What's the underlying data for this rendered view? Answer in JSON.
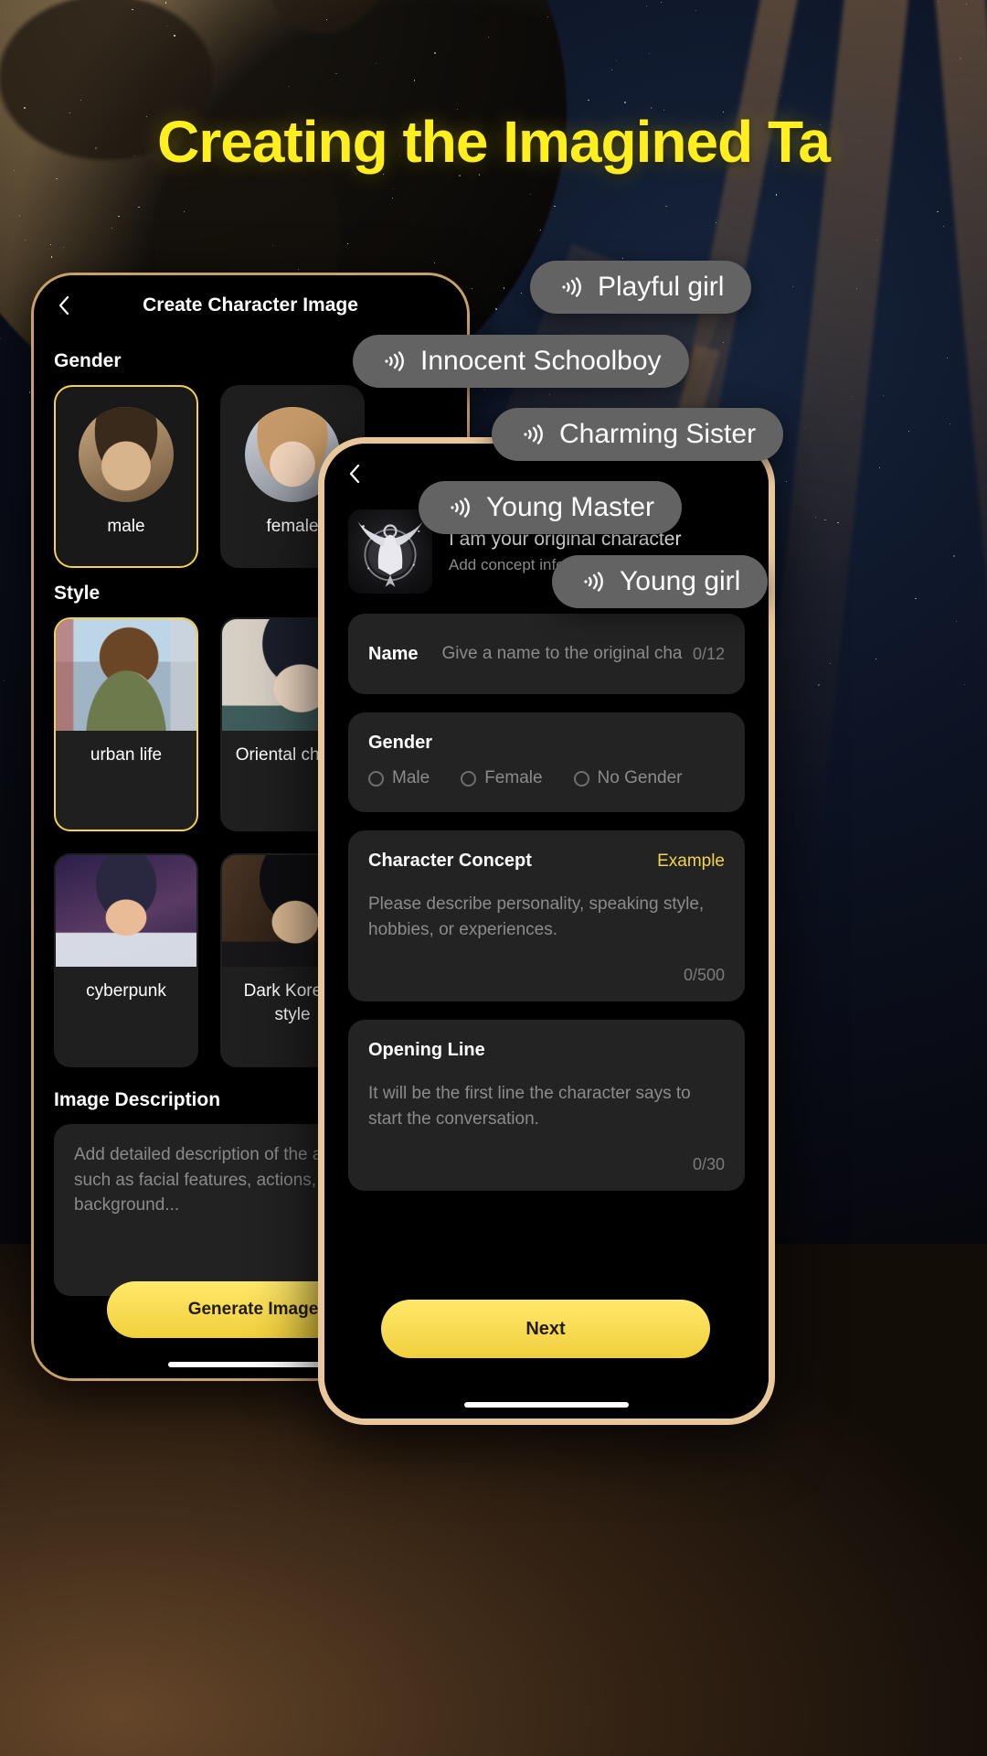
{
  "headline": "Creating the Imagined Ta",
  "left_phone": {
    "nav": {
      "back_icon": "chevron-left-icon",
      "title": "Create Character Image"
    },
    "gender": {
      "section_label": "Gender",
      "options": [
        {
          "label": "male",
          "selected": true
        },
        {
          "label": "female",
          "selected": false
        }
      ]
    },
    "style": {
      "section_label": "Style",
      "options": [
        {
          "label": "urban life",
          "selected": true
        },
        {
          "label": "Oriental charm",
          "selected": false
        },
        {
          "label": "cyberpunk",
          "selected": false
        },
        {
          "label": "Dark Korean style",
          "selected": false
        }
      ]
    },
    "image_description": {
      "section_label": "Image Description",
      "placeholder": "Add detailed description of the appearance, such as facial features, actions, clothing, background..."
    },
    "generate_button": "Generate Image"
  },
  "right_phone": {
    "nav": {
      "back_icon": "chevron-left-icon"
    },
    "header": {
      "avatar_icon": "winged-character-emblem-icon",
      "title": "I am your original character",
      "subtitle": "Add concept info"
    },
    "name_field": {
      "label": "Name",
      "placeholder": "Give a name to the original cha",
      "counter": "0/12"
    },
    "gender_field": {
      "label": "Gender",
      "options": [
        "Male",
        "Female",
        "No Gender"
      ]
    },
    "concept_field": {
      "label": "Character Concept",
      "example_link": "Example",
      "placeholder": "Please describe personality, speaking style, hobbies, or experiences.",
      "counter": "0/500"
    },
    "opening_field": {
      "label": "Opening Line",
      "placeholder": "It will be the first line the character says to start the conversation.",
      "counter": "0/30"
    },
    "next_button": "Next"
  },
  "voice_pills": [
    {
      "icon": "sound-wave-icon",
      "label": "Playful girl"
    },
    {
      "icon": "sound-wave-icon",
      "label": "Innocent Schoolboy"
    },
    {
      "icon": "sound-wave-icon",
      "label": "Charming Sister"
    },
    {
      "icon": "sound-wave-icon",
      "label": "Young Master"
    },
    {
      "icon": "sound-wave-icon",
      "label": "Young girl"
    }
  ],
  "colors": {
    "accent_yellow": "#f2d349",
    "headline_yellow": "#ffef1f",
    "frame_tan": "#eac79a",
    "pill_gray": "#636363",
    "card_gray": "#232323"
  }
}
